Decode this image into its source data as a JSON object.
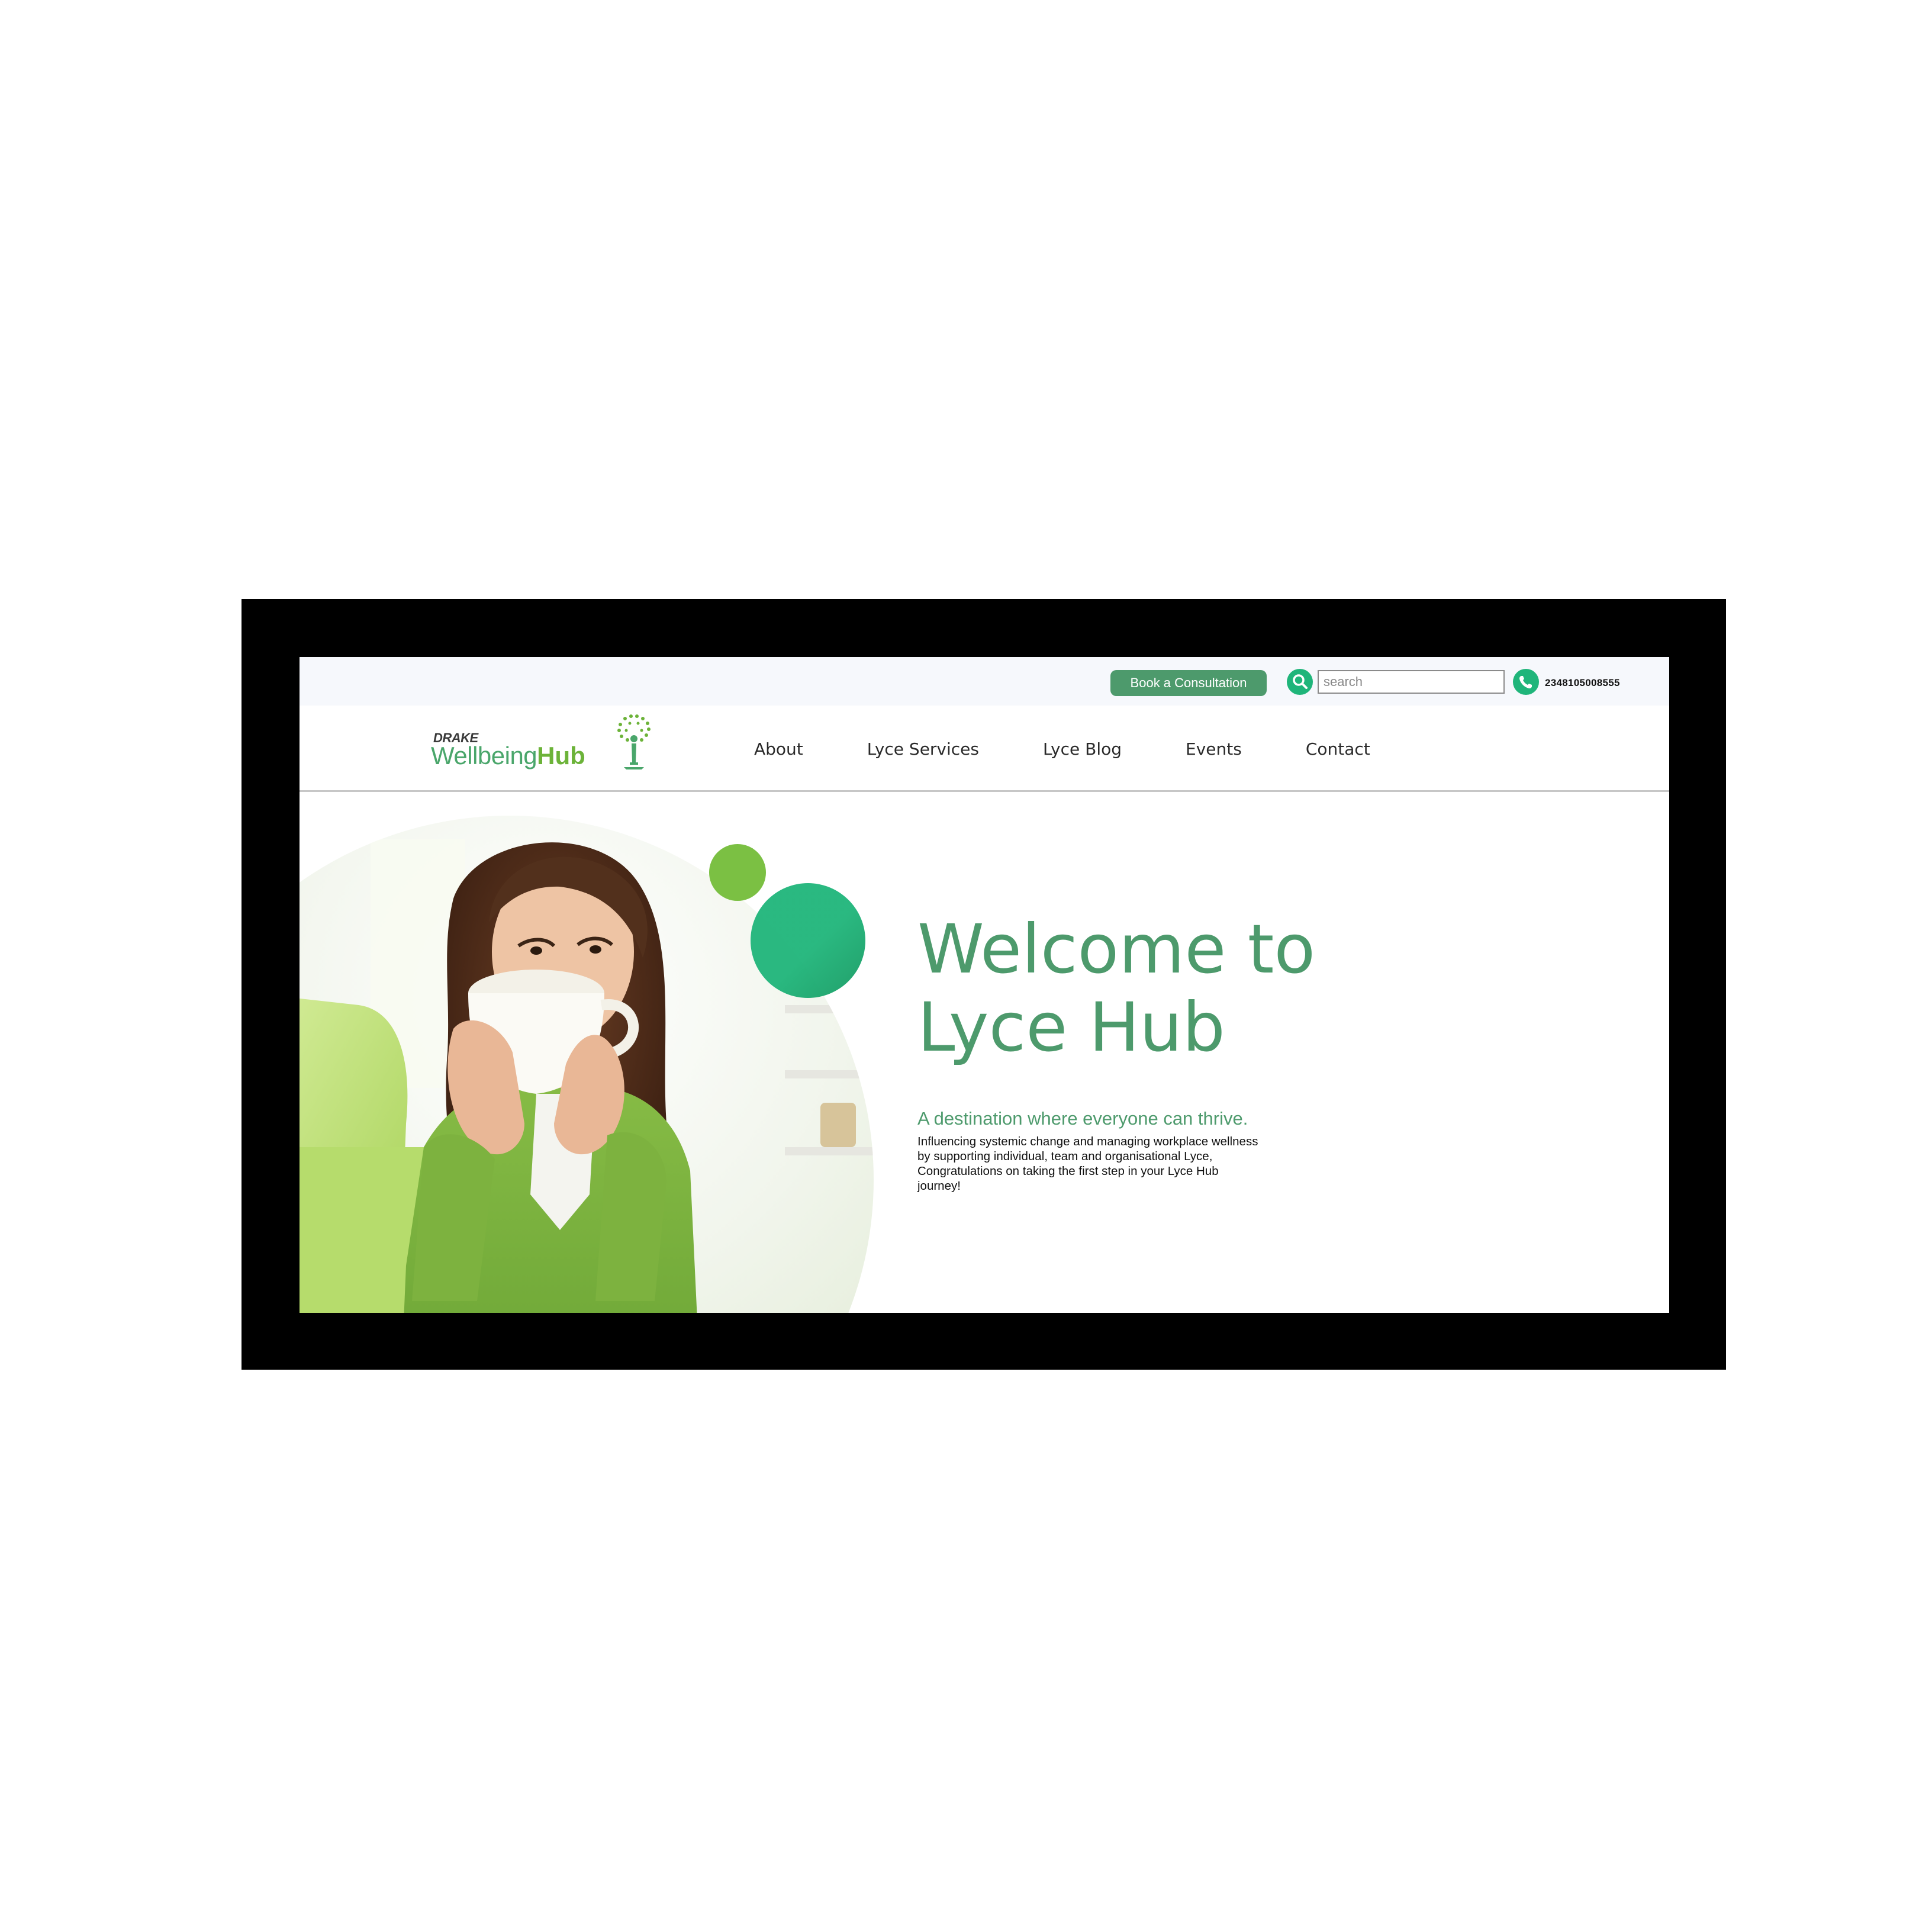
{
  "colors": {
    "brand_green": "#4d9a6c",
    "accent_teal": "#1fb57a",
    "accent_lime": "#7bc043",
    "logo_green": "#4aa66b",
    "logo_lime": "#6cb339",
    "frame": "#000000",
    "utility_bar_bg": "#f6f8fc"
  },
  "header": {
    "book_button_label": "Book a Consultation",
    "search_placeholder": "search",
    "search_icon": "search-icon",
    "phone_icon": "phone-icon",
    "phone_number": "2348105008555"
  },
  "logo": {
    "brand_prefix": "DRAKE",
    "name_part1": "Wellbeing",
    "name_part2": "Hub",
    "icon": "tree-icon"
  },
  "nav": {
    "items": [
      {
        "label": "About"
      },
      {
        "label": "Lyce Services"
      },
      {
        "label": "Lyce Blog"
      },
      {
        "label": "Events"
      },
      {
        "label": "Contact"
      }
    ]
  },
  "hero": {
    "title": "Welcome to\nLyce Hub",
    "subtitle": "A destination where everyone can thrive.",
    "body": "Influencing systemic change and managing workplace wellness by supporting individual, team and organisational Lyce, Congratulations on taking the first step in your Lyce Hub journey!",
    "photo": "woman-drinking-from-cup-photo"
  }
}
